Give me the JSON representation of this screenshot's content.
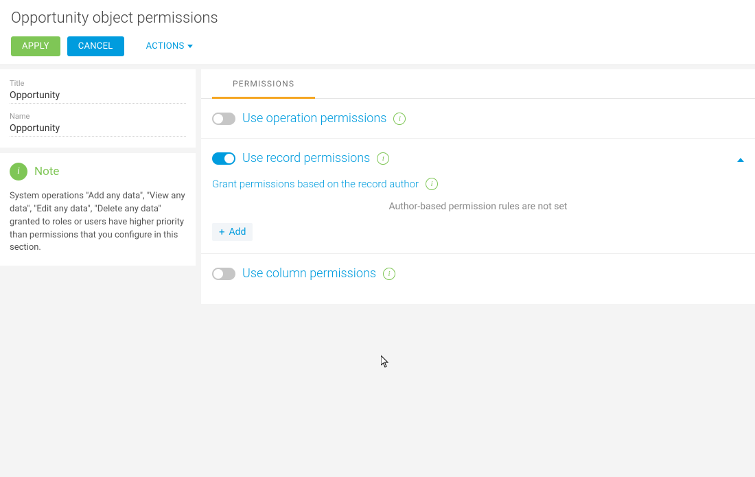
{
  "header": {
    "title": "Opportunity object permissions",
    "apply": "APPLY",
    "cancel": "CANCEL",
    "actions": "ACTIONS"
  },
  "sidebar": {
    "titleLabel": "Title",
    "titleValue": "Opportunity",
    "nameLabel": "Name",
    "nameValue": "Opportunity"
  },
  "note": {
    "heading": "Note",
    "body": "System operations \"Add any data\", \"View any data\", \"Edit any data\", \"Delete any data\" granted to roles or users have higher priority than permissions that you configure in this section."
  },
  "tabs": {
    "permissions": "PERMISSIONS"
  },
  "sections": {
    "operation": {
      "label": "Use operation permissions",
      "on": false
    },
    "record": {
      "label": "Use record permissions",
      "on": true,
      "subLabel": "Grant permissions based on the record author",
      "emptyMsg": "Author-based permission rules are not set",
      "addLabel": "Add"
    },
    "column": {
      "label": "Use column permissions",
      "on": false
    }
  }
}
